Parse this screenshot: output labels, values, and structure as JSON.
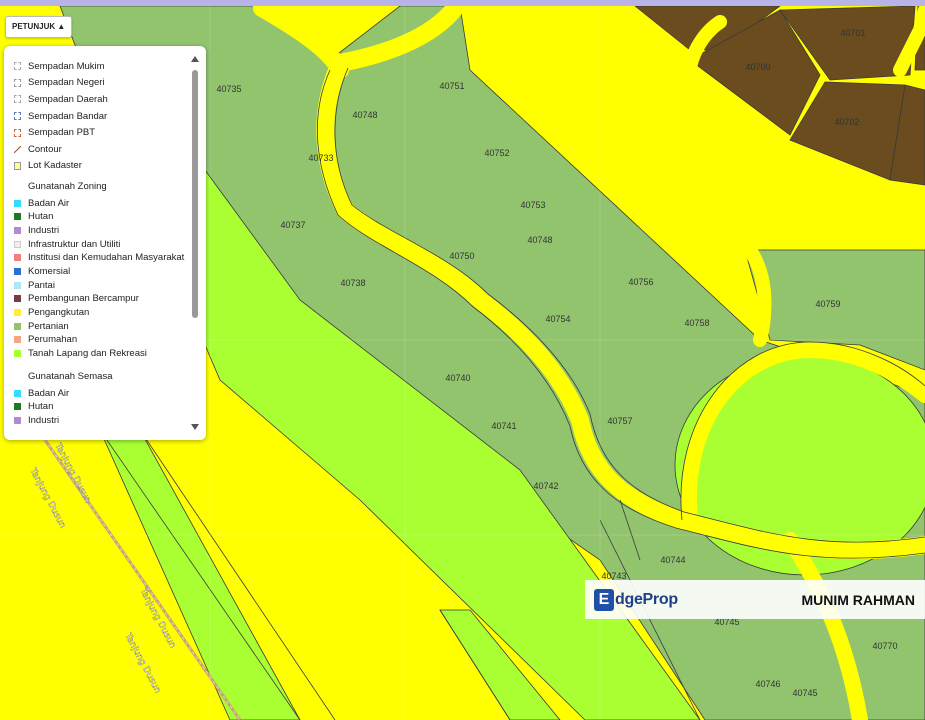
{
  "map": {
    "colors": {
      "pertanian": "#92c46e",
      "pengangkutan": "#ffff00",
      "tanah_lapang": "#aaff33",
      "pembangunan": "#6b4c1e",
      "boundary": "#3a3a3a"
    },
    "lots": [
      "40735",
      "40751",
      "40748",
      "40752",
      "40733",
      "40753",
      "40748",
      "40737",
      "40750",
      "40756",
      "40738",
      "40754",
      "40758",
      "40759",
      "40740",
      "40741",
      "40757",
      "40742",
      "40744",
      "40743",
      "40745",
      "40770",
      "40746",
      "40745",
      "40702",
      "40700",
      "40701"
    ],
    "road_labels": [
      "Tanjung Dusun",
      "Tanjung Dusun",
      "Tanjung Dusun",
      "Tanjung Dusun"
    ]
  },
  "toolbar": {
    "petunjuk_label": "PETUNJUK ▲"
  },
  "legend": {
    "boundaries": [
      {
        "label": "Sempadan Mukim",
        "color": "#aaaaaa"
      },
      {
        "label": "Sempadan Negeri",
        "color": "#999999"
      },
      {
        "label": "Sempadan Daerah",
        "color": "#aaaaaa"
      },
      {
        "label": "Sempadan Bandar",
        "color": "#5577cc"
      },
      {
        "label": "Sempadan PBT",
        "color": "#cc6633"
      }
    ],
    "contour_label": "Contour",
    "contour_color": "#a0522d",
    "lot_label": "Lot Kadaster",
    "lot_color": "#ffff99",
    "zoning_title": "Gunatanah Zoning",
    "zoning": [
      {
        "label": "Badan Air",
        "color": "#33ddff"
      },
      {
        "label": "Hutan",
        "color": "#1f7a1f"
      },
      {
        "label": "Industri",
        "color": "#b388d8"
      },
      {
        "label": "Infrastruktur dan Utiliti",
        "color": "#f5eee6"
      },
      {
        "label": "Institusi dan Kemudahan Masyarakat",
        "color": "#f08080"
      },
      {
        "label": "Komersial",
        "color": "#2a6fd6"
      },
      {
        "label": "Pantai",
        "color": "#aee6f5"
      },
      {
        "label": "Pembangunan Bercampur",
        "color": "#7a3a4a"
      },
      {
        "label": "Pengangkutan",
        "color": "#ffee33"
      },
      {
        "label": "Pertanian",
        "color": "#92c46e"
      },
      {
        "label": "Perumahan",
        "color": "#f4a582"
      },
      {
        "label": "Tanah Lapang dan Rekreasi",
        "color": "#aaff33"
      }
    ],
    "semasa_title": "Gunatanah Semasa",
    "semasa": [
      {
        "label": "Badan Air",
        "color": "#33ddff"
      },
      {
        "label": "Hutan",
        "color": "#1f7a1f"
      },
      {
        "label": "Industri",
        "color": "#b388d8"
      }
    ]
  },
  "watermark": {
    "logo_mark": "E",
    "logo_text": "dgeProp",
    "name": "MUNIM RAHMAN"
  }
}
